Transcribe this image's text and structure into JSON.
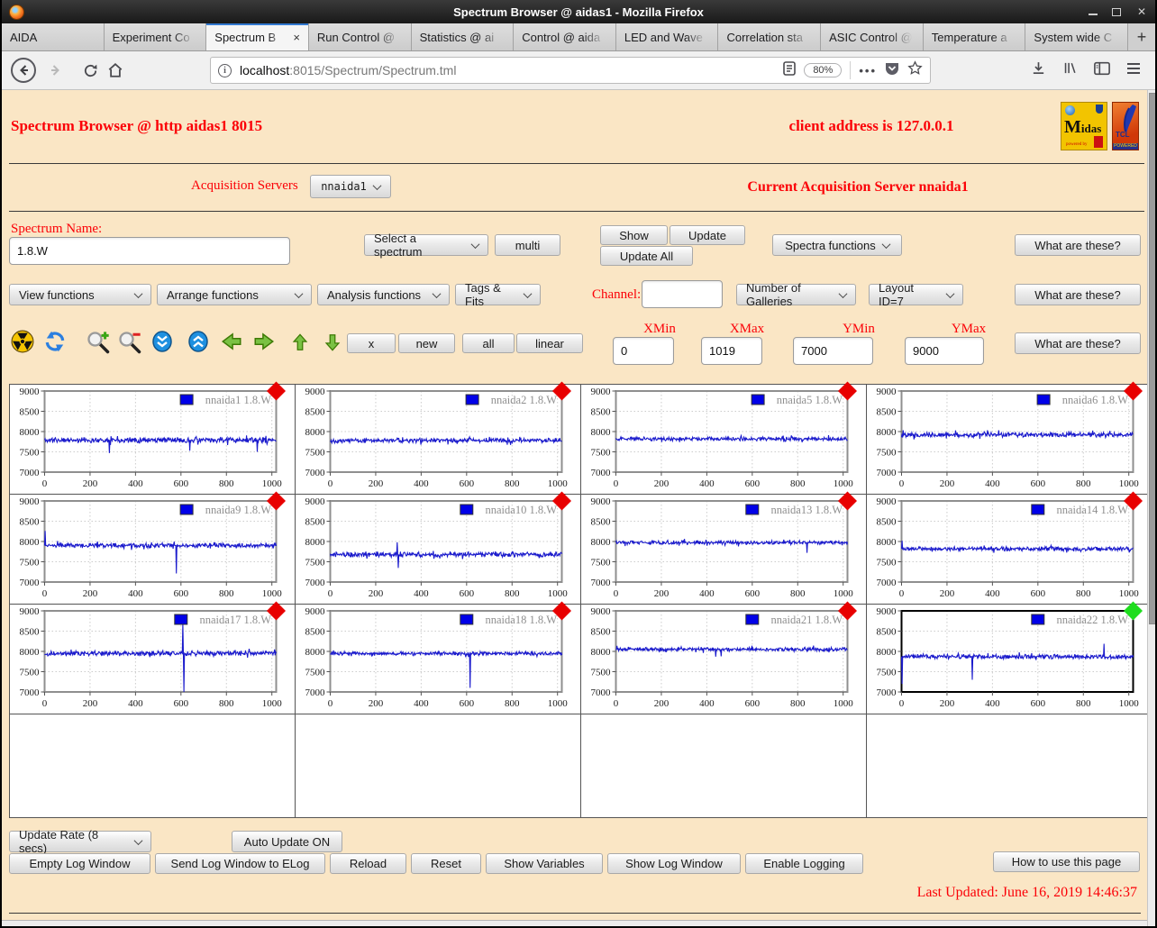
{
  "window": {
    "title": "Spectrum Browser @ aidas1 - Mozilla Firefox"
  },
  "browser": {
    "tabs": [
      {
        "label": "AIDA",
        "active": false
      },
      {
        "label": "Experiment Co",
        "active": false
      },
      {
        "label": "Spectrum B",
        "active": true,
        "close": "×"
      },
      {
        "label": "Run Control @",
        "active": false
      },
      {
        "label": "Statistics @ ai",
        "active": false
      },
      {
        "label": "Control @ aida",
        "active": false
      },
      {
        "label": "LED and Wave",
        "active": false
      },
      {
        "label": "Correlation sta",
        "active": false
      },
      {
        "label": "ASIC Control @",
        "active": false
      },
      {
        "label": "Temperature a",
        "active": false
      },
      {
        "label": "System wide C",
        "active": false
      }
    ],
    "new_tab_label": "+",
    "url_host": "localhost",
    "url_rest": ":8015/Spectrum/Spectrum.tml",
    "zoom_level": "80%",
    "dots": "•••"
  },
  "page": {
    "title": "Spectrum Browser @ http aidas1 8015",
    "client": "client address is 127.0.0.1",
    "logos": {
      "midas": "Midas",
      "midas_sub": "powered by",
      "tcl": "TCL",
      "tcl_strip": "POWERED"
    },
    "acquisition": {
      "label": "Acquisition Servers",
      "selected": "nnaida1",
      "current": "Current Acquisition Server nnaida1"
    },
    "spectrum": {
      "label": "Spectrum Name:",
      "value": "1.8.W",
      "select_label": "Select a spectrum",
      "multi": "multi",
      "show": "Show",
      "update": "Update",
      "update_all": "Update All",
      "spectra_functions": "Spectra functions",
      "what": "What are these?"
    },
    "functions_row": {
      "view": "View functions",
      "arrange": "Arrange functions",
      "analysis": "Analysis functions",
      "tags": "Tags & Fits",
      "channel_label": "Channel:",
      "channel_value": "",
      "galleries": "Number of Galleries",
      "layout": "Layout ID=7",
      "what": "What are these?"
    },
    "toolbar": {
      "buttons": [
        "x",
        "new",
        "all",
        "linear"
      ],
      "icons": [
        "radiation",
        "refresh",
        "zoom-in",
        "zoom-out",
        "scroll-down",
        "scroll-up",
        "arrow-left",
        "arrow-right",
        "arrow-up",
        "arrow-down"
      ],
      "range": {
        "xmin_label": "XMin",
        "xmin": "0",
        "xmax_label": "XMax",
        "xmax": "1019",
        "ymin_label": "YMin",
        "ymin": "7000",
        "ymax_label": "YMax",
        "ymax": "9000"
      },
      "what": "What are these?"
    },
    "footer": {
      "update_rate": "Update Rate (8 secs)",
      "auto_update": "Auto Update ON",
      "buttons": [
        "Empty Log Window",
        "Send Log Window to ELog",
        "Reload",
        "Reset",
        "Show Variables",
        "Show Log Window",
        "Enable Logging"
      ],
      "help": "How to use this page",
      "last_updated": "Last Updated: June 16, 2019 14:46:37",
      "status_dot": "."
    }
  },
  "chart_data": {
    "type": "line",
    "xlim": [
      0,
      1019
    ],
    "ylim": [
      7000,
      9000
    ],
    "xticks": [
      0,
      200,
      400,
      600,
      800,
      1000
    ],
    "yticks": [
      7000,
      7500,
      8000,
      8500,
      9000
    ],
    "line_color": "#1a1acc",
    "grid": "dotted",
    "legend_position": "top-right",
    "series": [
      {
        "name": "nnaida1",
        "legend": "nnaida1 1.8.W",
        "baseline": 7790,
        "noise": 75,
        "seed": 11,
        "marker": "#e80000",
        "selected": false,
        "spikes": [
          {
            "x": 285,
            "y": 7470
          },
          {
            "x": 640,
            "y": 7530
          },
          {
            "x": 935,
            "y": 7500
          }
        ]
      },
      {
        "name": "nnaida2",
        "legend": "nnaida2 1.8.W",
        "baseline": 7780,
        "noise": 65,
        "seed": 22,
        "marker": "#e80000",
        "selected": false,
        "spikes": []
      },
      {
        "name": "nnaida5",
        "legend": "nnaida5 1.8.W",
        "baseline": 7820,
        "noise": 55,
        "seed": 55,
        "marker": "#e80000",
        "selected": false,
        "spikes": []
      },
      {
        "name": "nnaida6",
        "legend": "nnaida6 1.8.W",
        "baseline": 7920,
        "noise": 70,
        "seed": 66,
        "marker": "#e80000",
        "selected": false,
        "spikes": []
      },
      {
        "name": "nnaida9",
        "legend": "nnaida9 1.8.W",
        "baseline": 7900,
        "noise": 65,
        "seed": 99,
        "marker": "#e80000",
        "selected": false,
        "spikes": [
          {
            "x": 2,
            "y": 8260
          },
          {
            "x": 580,
            "y": 7210
          }
        ]
      },
      {
        "name": "nnaida10",
        "legend": "nnaida10 1.8.W",
        "baseline": 7680,
        "noise": 70,
        "seed": 1010,
        "marker": "#e80000",
        "selected": false,
        "spikes": [
          {
            "x": 295,
            "y": 7980
          },
          {
            "x": 300,
            "y": 7350
          }
        ]
      },
      {
        "name": "nnaida13",
        "legend": "nnaida13 1.8.W",
        "baseline": 7970,
        "noise": 55,
        "seed": 1313,
        "marker": "#e80000",
        "selected": false,
        "spikes": [
          {
            "x": 840,
            "y": 7720
          }
        ]
      },
      {
        "name": "nnaida14",
        "legend": "nnaida14 1.8.W",
        "baseline": 7820,
        "noise": 60,
        "seed": 1414,
        "marker": "#e80000",
        "selected": false,
        "spikes": [
          {
            "x": 3,
            "y": 8020
          }
        ]
      },
      {
        "name": "nnaida17",
        "legend": "nnaida17 1.8.W",
        "baseline": 7950,
        "noise": 70,
        "seed": 1717,
        "marker": "#e80000",
        "selected": false,
        "spikes": [
          {
            "x": 608,
            "y": 8700
          },
          {
            "x": 612,
            "y": 7000
          }
        ]
      },
      {
        "name": "nnaida18",
        "legend": "nnaida18 1.8.W",
        "baseline": 7950,
        "noise": 55,
        "seed": 1818,
        "marker": "#e80000",
        "selected": false,
        "spikes": [
          {
            "x": 615,
            "y": 7100
          }
        ]
      },
      {
        "name": "nnaida21",
        "legend": "nnaida21 1.8.W",
        "baseline": 8050,
        "noise": 55,
        "seed": 2121,
        "marker": "#e80000",
        "selected": false,
        "spikes": [
          {
            "x": 440,
            "y": 7870
          },
          {
            "x": 462,
            "y": 7880
          }
        ]
      },
      {
        "name": "nnaida22",
        "legend": "nnaida22 1.8.W",
        "baseline": 7870,
        "noise": 65,
        "seed": 2222,
        "marker": "#1fdd1f",
        "selected": true,
        "spikes": [
          {
            "x": 3,
            "y": 7200
          },
          {
            "x": 310,
            "y": 7300
          },
          {
            "x": 890,
            "y": 8190
          }
        ]
      }
    ]
  }
}
